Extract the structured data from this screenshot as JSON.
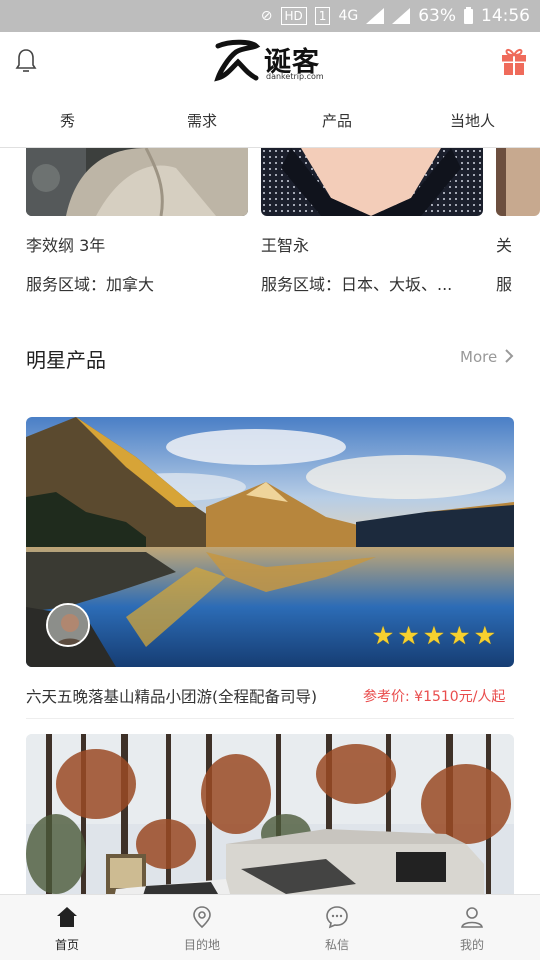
{
  "status_bar": {
    "network": "4G",
    "badge": "HD",
    "sim": "1",
    "battery": "63%",
    "time": "14:56"
  },
  "header": {
    "logo_text": "诞客",
    "logo_sub": "danketrip.com"
  },
  "tabs": [
    {
      "label": "秀"
    },
    {
      "label": "需求"
    },
    {
      "label": "产品"
    },
    {
      "label": "当地人"
    }
  ],
  "people": [
    {
      "name": "李效纲 3年",
      "area": "服务区域：加拿大"
    },
    {
      "name": "王智永",
      "area": "服务区域：日本、大坂、..."
    },
    {
      "name": "关",
      "area": "服"
    }
  ],
  "featured": {
    "title": "明星产品",
    "more_label": "More"
  },
  "products": [
    {
      "title": "六天五晚落基山精品小团游(全程配备司导)",
      "price": "参考价: ¥1510元/人起",
      "rating": 5
    }
  ],
  "bottom_nav": [
    {
      "label": "首页",
      "icon": "home-icon",
      "active": true
    },
    {
      "label": "目的地",
      "icon": "location-pin-icon",
      "active": false
    },
    {
      "label": "私信",
      "icon": "chat-bubble-icon",
      "active": false
    },
    {
      "label": "我的",
      "icon": "user-icon",
      "active": false
    }
  ],
  "colors": {
    "price": "#e94d4d",
    "star": "#f6d02f",
    "gift": "#ef6b5b",
    "status_bar": "#bdbdbd"
  }
}
